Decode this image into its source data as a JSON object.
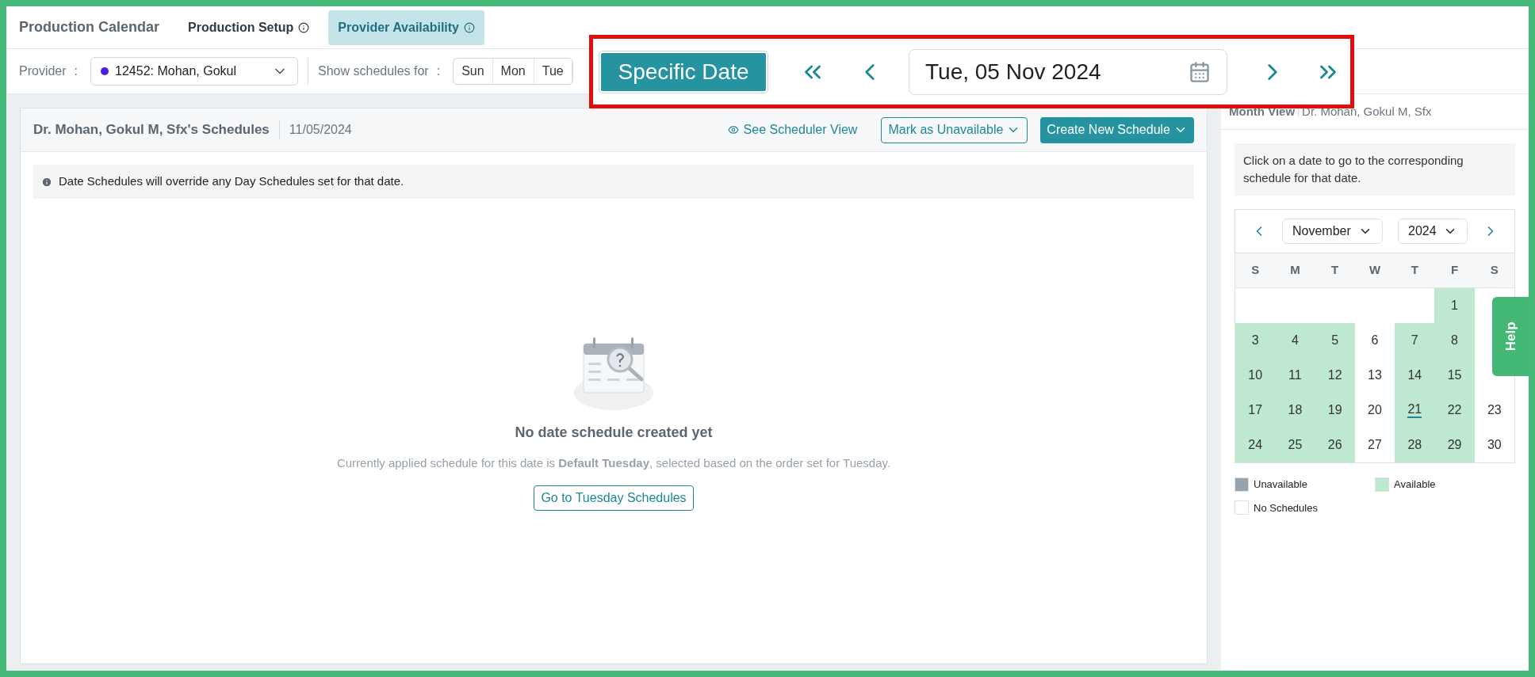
{
  "header": {
    "title": "Production Calendar",
    "tabs": [
      {
        "label": "Production Setup",
        "selected": false
      },
      {
        "label": "Provider Availability",
        "selected": true
      }
    ]
  },
  "toolbar": {
    "provider_label": "Provider",
    "separator": ":",
    "provider": {
      "value": "12452: Mohan, Gokul",
      "color": "#4f1ee6"
    },
    "show_label": "Show schedules for",
    "show_separator": ":",
    "days": [
      {
        "label": "Sun",
        "selected": false
      },
      {
        "label": "Mon",
        "selected": false
      },
      {
        "label": "Tue",
        "selected": false
      }
    ]
  },
  "highlight": {
    "mode_button": "Specific Date",
    "date": "Tue, 05 Nov 2024"
  },
  "schedule_panel": {
    "title": "Dr. Mohan, Gokul M, Sfx's Schedules",
    "date": "11/05/2024",
    "actions": {
      "scheduler_view": "See Scheduler View",
      "mark_unavailable": "Mark as Unavailable",
      "create": "Create New Schedule"
    },
    "notice": "Date Schedules will override any Day Schedules set for that date.",
    "empty": {
      "heading": "No date schedule created yet",
      "message": "Currently applied schedule for this date is **Default Tuesday**, selected based on the order set for Tuesday.",
      "button": "Go to Tuesday Schedules"
    }
  },
  "month_view": {
    "title": "Month View",
    "provider": "Dr. Mohan, Gokul M, Sfx",
    "hint": "Click on a date to go to the corresponding schedule for that date.",
    "month": "November",
    "year": "2024",
    "weekdays": [
      "S",
      "M",
      "T",
      "W",
      "T",
      "F",
      "S"
    ],
    "weeks": [
      [
        {
          "kind": "blank"
        },
        {
          "kind": "blank"
        },
        {
          "kind": "blank"
        },
        {
          "kind": "blank"
        },
        {
          "kind": "blank"
        },
        {
          "kind": "day",
          "day": "1",
          "available": true
        },
        {
          "kind": "blank"
        }
      ],
      [
        {
          "kind": "day",
          "day": "3",
          "available": true
        },
        {
          "kind": "day",
          "day": "4",
          "available": true
        },
        {
          "kind": "day",
          "day": "5",
          "available": true
        },
        {
          "kind": "day",
          "day": "6",
          "available": false
        },
        {
          "kind": "day",
          "day": "7",
          "available": true
        },
        {
          "kind": "day",
          "day": "8",
          "available": true
        },
        {
          "kind": "blank"
        }
      ],
      [
        {
          "kind": "day",
          "day": "10",
          "available": true
        },
        {
          "kind": "day",
          "day": "11",
          "available": true
        },
        {
          "kind": "day",
          "day": "12",
          "available": true
        },
        {
          "kind": "day",
          "day": "13",
          "available": false
        },
        {
          "kind": "day",
          "day": "14",
          "available": true
        },
        {
          "kind": "day",
          "day": "15",
          "available": true
        },
        {
          "kind": "blank"
        }
      ],
      [
        {
          "kind": "day",
          "day": "17",
          "available": true
        },
        {
          "kind": "day",
          "day": "18",
          "available": true
        },
        {
          "kind": "day",
          "day": "19",
          "available": true
        },
        {
          "kind": "day",
          "day": "20",
          "available": false
        },
        {
          "kind": "day",
          "day": "21",
          "available": true,
          "today": true
        },
        {
          "kind": "day",
          "day": "22",
          "available": true
        },
        {
          "kind": "day",
          "day": "23",
          "available": false
        }
      ],
      [
        {
          "kind": "day",
          "day": "24",
          "available": true
        },
        {
          "kind": "day",
          "day": "25",
          "available": true
        },
        {
          "kind": "day",
          "day": "26",
          "available": true
        },
        {
          "kind": "day",
          "day": "27",
          "available": false
        },
        {
          "kind": "day",
          "day": "28",
          "available": true
        },
        {
          "kind": "day",
          "day": "29",
          "available": true
        },
        {
          "kind": "day",
          "day": "30",
          "available": false
        }
      ]
    ],
    "legend": [
      {
        "label": "Unavailable",
        "color": "#94a3ae"
      },
      {
        "label": "Available",
        "color": "#bfe8d0"
      },
      {
        "label": "No Schedules",
        "color": "#ffffff"
      }
    ]
  },
  "help_tab": "Help"
}
